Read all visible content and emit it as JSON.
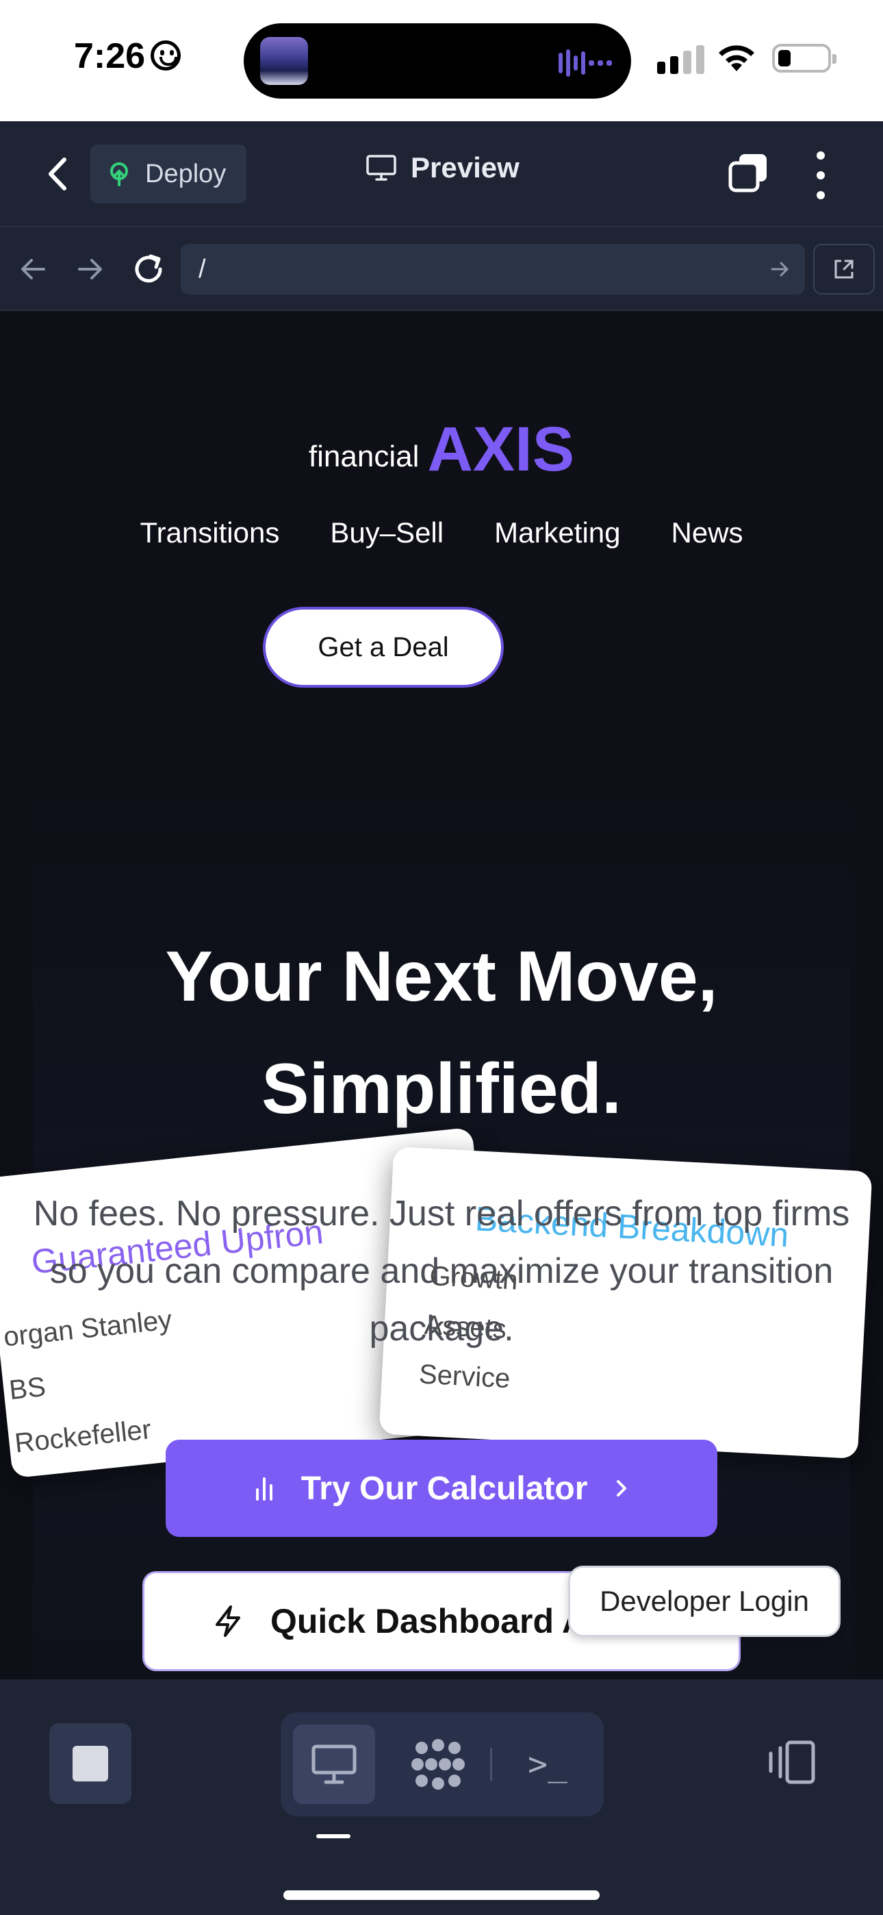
{
  "status_bar": {
    "time": "7:26"
  },
  "app_header": {
    "deploy_label": "Deploy",
    "preview_label": "Preview"
  },
  "url_bar": {
    "value": "/"
  },
  "site": {
    "brand_small": "financial",
    "brand_big": "AXIS",
    "brand_color": "#7c5cf4",
    "nav": [
      "Transitions",
      "Buy–Sell",
      "Marketing",
      "News"
    ],
    "cta_deal": "Get a Deal",
    "headline_line1": "Your Next Move,",
    "headline_line2": "Simplified.",
    "card_left": {
      "title": "Guaranteed Upfron",
      "items": [
        "organ Stanley",
        "BS",
        "Rockefeller"
      ]
    },
    "card_right": {
      "title": "Backend Breakdown",
      "items": [
        "Growth",
        "Assets",
        "Service"
      ]
    },
    "subtext": "No fees. No pressure. Just real offers from top firms so you can compare and maximize your transition package.",
    "calc_button": "Try Our Calculator",
    "dashboard_button": "Quick Dashboard A",
    "developer_login": "Developer Login"
  },
  "toolbar": {
    "terminal_glyph": ">_"
  }
}
